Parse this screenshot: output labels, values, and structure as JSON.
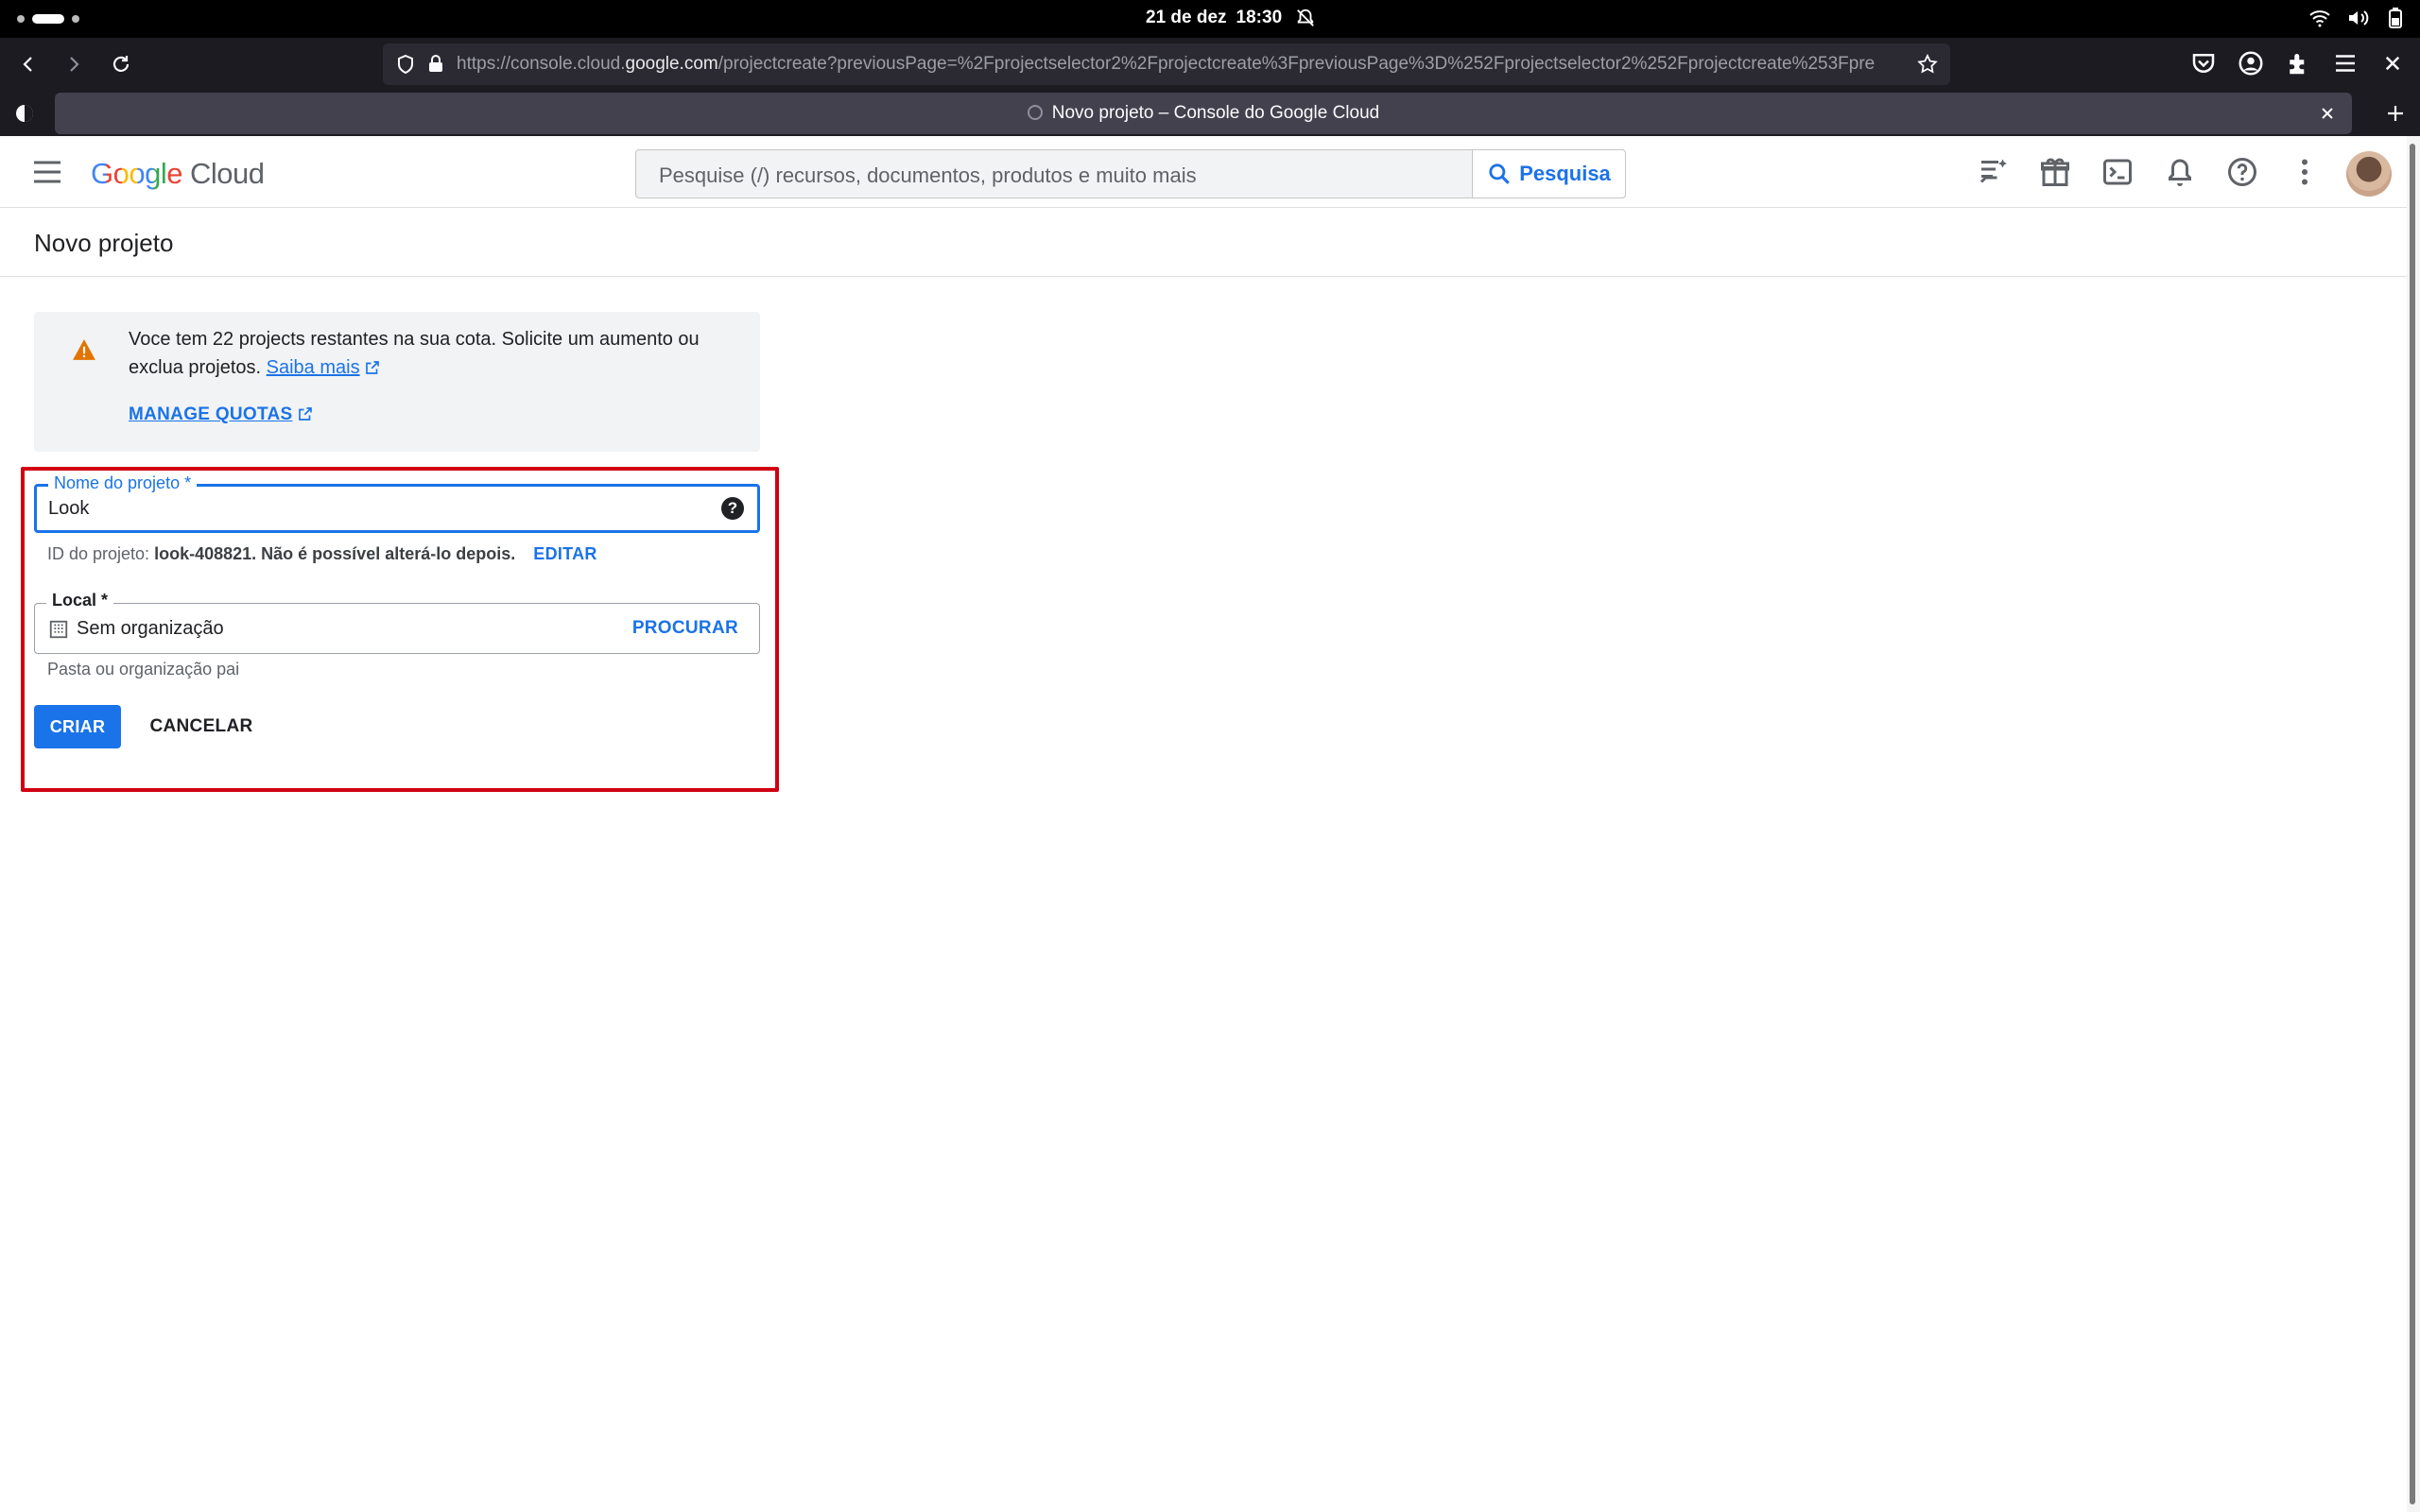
{
  "system": {
    "date": "21 de dez",
    "time": "18:30"
  },
  "browser": {
    "url_prefix": "https://console.cloud.",
    "url_domain": "google.com",
    "url_rest": "/projectcreate?previousPage=%2Fprojectselector2%2Fprojectcreate%3FpreviousPage%3D%252Fprojectselector2%252Fprojectcreate%253Fpre",
    "tab_title": "Novo projeto – Console do Google Cloud"
  },
  "header": {
    "logo_brand": "Google",
    "logo_product": "Cloud",
    "search_placeholder": "Pesquise (/) recursos, documentos, produtos e muito mais",
    "search_button": "Pesquisa"
  },
  "page": {
    "title": "Novo projeto"
  },
  "notice": {
    "message": "Voce tem 22 projects restantes na sua cota. Solicite um aumento ou exclua projetos.",
    "learn_more": "Saiba mais",
    "manage_quotas": "MANAGE QUOTAS"
  },
  "form": {
    "name_label": "Nome do projeto *",
    "name_value": "Look",
    "id_prefix": "ID do projeto:",
    "id_value": "look-408821.",
    "id_suffix": "Não é possível alterá-lo depois.",
    "edit_label": "EDITAR",
    "location_label": "Local *",
    "location_value": "Sem organização",
    "browse_label": "PROCURAR",
    "location_hint": "Pasta ou organização pai",
    "create_button": "CRIAR",
    "cancel_button": "CANCELAR"
  },
  "colors": {
    "accent": "#1a73e8",
    "warning": "#e37400",
    "highlight": "#d10012"
  }
}
